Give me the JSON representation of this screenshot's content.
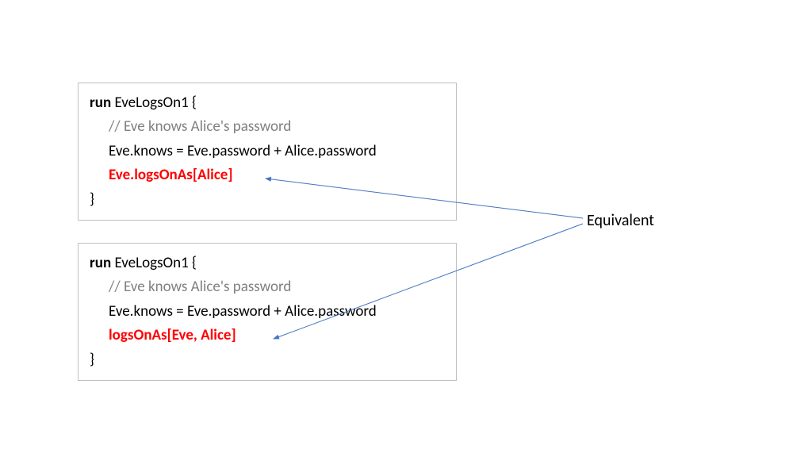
{
  "box1": {
    "keyword": "run",
    "name": " EveLogsOn1 {",
    "comment": "// Eve knows Alice's password",
    "line3": "Eve.knows = Eve.password + Alice.password",
    "highlight": "Eve.logsOnAs[Alice]",
    "close": "}"
  },
  "box2": {
    "keyword": "run",
    "name": " EveLogsOn1 {",
    "comment": "// Eve knows Alice's password",
    "line3": "Eve.knows = Eve.password + Alice.password",
    "highlight": "logsOnAs[Eve, Alice]",
    "close": "}"
  },
  "label": "Equivalent"
}
